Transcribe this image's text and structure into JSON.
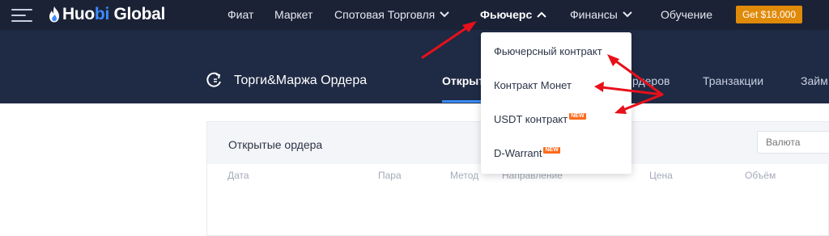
{
  "header": {
    "logo": {
      "text_pre": "Huo",
      "text_bi": "bi",
      "text_post": " Global"
    },
    "nav": [
      {
        "label": "Фиат",
        "has_chevron": false
      },
      {
        "label": "Маркет",
        "has_chevron": false
      },
      {
        "label": "Спотовая Торговля",
        "has_chevron": true
      },
      {
        "label": "Фьючерс",
        "has_chevron": true,
        "active": true
      },
      {
        "label": "Финансы",
        "has_chevron": true
      },
      {
        "label": "Обучение",
        "has_chevron": false
      }
    ],
    "promo_label": "Get $18,000"
  },
  "subheader": {
    "title": "Торги&Маржа Ордера",
    "tabs": [
      "Открыт",
      "рдеров",
      "Транзакции",
      "Займ"
    ]
  },
  "futures_menu": {
    "items": [
      {
        "label": "Фьючерсный контракт",
        "badge": ""
      },
      {
        "label": "Контракт Монет",
        "badge": ""
      },
      {
        "label": "USDT контракт",
        "badge": "NEW"
      },
      {
        "label": "D-Warrant",
        "badge": "NEW"
      }
    ]
  },
  "orders_panel": {
    "title": "Открытые ордера",
    "currency_placeholder": "Валюта",
    "columns": [
      "Дата",
      "Пара",
      "Метод",
      "Направление",
      "Цена",
      "Объём"
    ]
  },
  "colors": {
    "topbar": "#1b2236",
    "subbar": "#1f2a44",
    "accent_blue": "#3b8cff",
    "promo": "#e08a0a",
    "badge_new": "#ff6a1a",
    "annotation_arrow": "#e8101a"
  },
  "icons": {
    "menu": "hamburger-icon",
    "logo": "flame-logo-icon",
    "subheader": "refresh-orders-icon",
    "dropdown": "chevron-down-icon",
    "dropdown_open": "chevron-up-icon"
  }
}
